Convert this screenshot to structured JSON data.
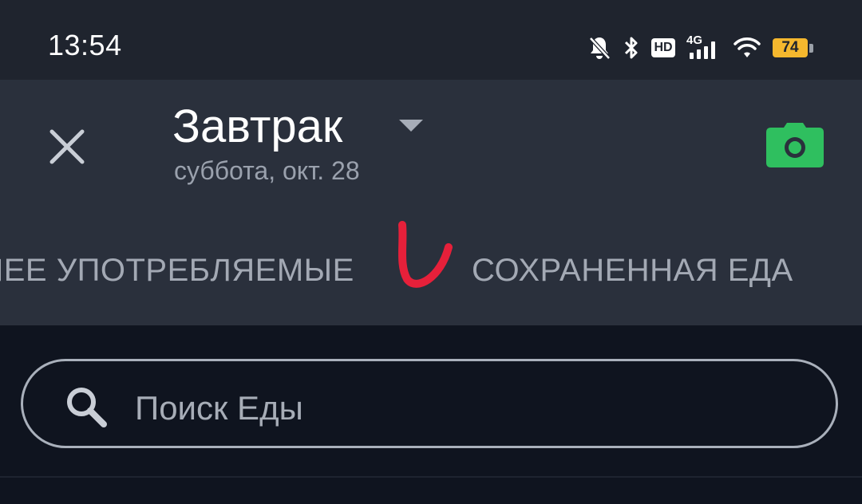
{
  "status_bar": {
    "time": "13:54",
    "icons": [
      "bell-muted-icon",
      "bluetooth-icon",
      "hd-icon",
      "signal-4g-icon",
      "wifi-icon",
      "battery-icon"
    ],
    "hd_label": "HD",
    "network_label": "4G",
    "battery_level": "74",
    "battery_color": "#f5b82e"
  },
  "header": {
    "close_icon": "close-icon",
    "meal_title": "Завтрак",
    "meal_date": "суббота, окт. 28",
    "camera_icon": "camera-icon",
    "camera_color": "#2fbf5f"
  },
  "tabs": [
    {
      "label": "ЛЕЕ УПОТРЕБЛЯЕМЫЕ"
    },
    {
      "label": "СОХРАНЕННАЯ ЕДА"
    }
  ],
  "annotation": {
    "color": "#e6203a"
  },
  "search": {
    "placeholder": "Поиск Еды",
    "icon": "search-icon"
  },
  "colors": {
    "status_bar_bg": "#1f242e",
    "header_bg": "#2a303c",
    "page_bg": "#0f141f"
  }
}
